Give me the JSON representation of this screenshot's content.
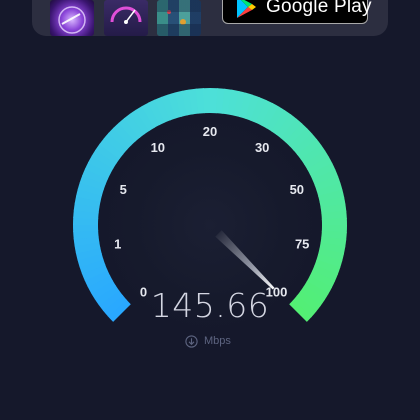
{
  "ad": {
    "store_button_label": "Google Play",
    "thumbnails": [
      "speed-globe-icon",
      "speedometer-icon",
      "signal-map-icon"
    ]
  },
  "gauge": {
    "scale_labels": [
      "0",
      "1",
      "5",
      "10",
      "20",
      "30",
      "50",
      "75",
      "100"
    ],
    "needle_value": 100,
    "colors": {
      "start": "#29a8ff",
      "mid": "#4de0d8",
      "end": "#53ef72",
      "track": "#15182b"
    }
  },
  "result": {
    "speed": "145.66",
    "unit": "Mbps",
    "direction_icon": "download-arrow-icon"
  }
}
